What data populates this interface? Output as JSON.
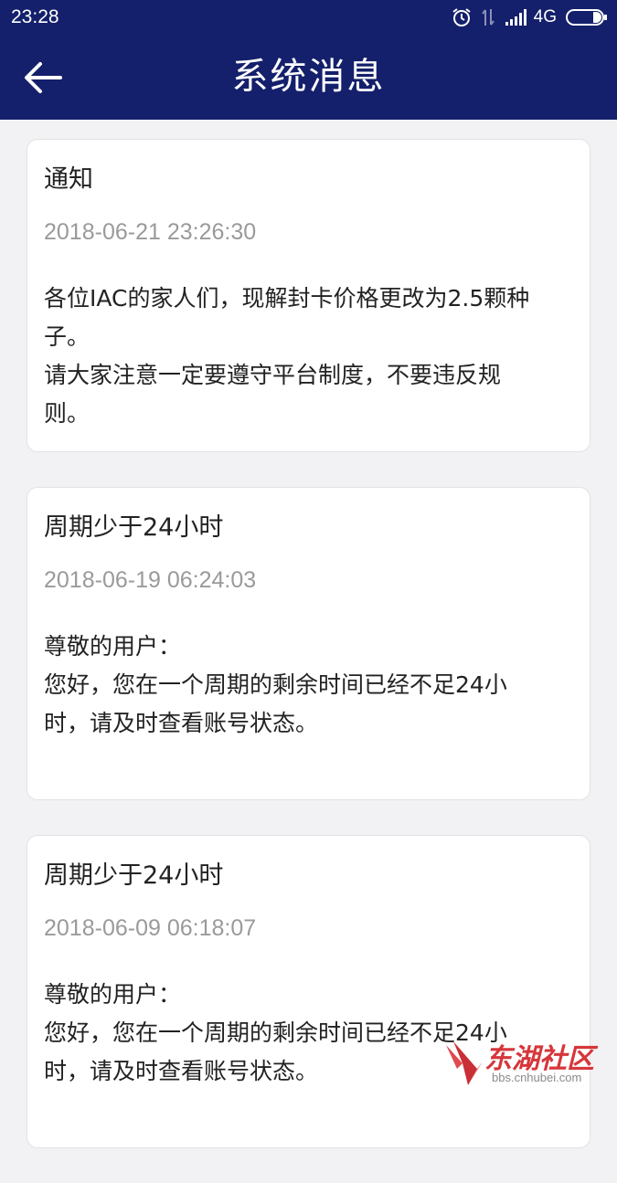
{
  "status_bar": {
    "time": "23:28",
    "network": "4G",
    "icons": [
      "alarm-icon",
      "data-transfer-icon",
      "signal-icon",
      "battery-icon"
    ]
  },
  "app_bar": {
    "title": "系统消息",
    "back_icon": "arrow-left-icon",
    "background_color": "#14206b"
  },
  "messages": [
    {
      "title": "通知",
      "time": "2018-06-21 23:26:30",
      "body": [
        "各位IAC的家人们，现解封卡价格更改为2.5颗种",
        "子。",
        "请大家注意一定要遵守平台制度，不要违反规",
        "则。"
      ]
    },
    {
      "title": "周期少于24小时",
      "time": "2018-06-19 06:24:03",
      "body": [
        "尊敬的用户：",
        "您好，您在一个周期的剩余时间已经不足24小",
        "时，请及时查看账号状态。"
      ]
    },
    {
      "title": "周期少于24小时",
      "time": "2018-06-09 06:18:07",
      "body": [
        "尊敬的用户：",
        "您好，您在一个周期的剩余时间已经不足24小",
        "时，请及时查看账号状态。"
      ]
    }
  ],
  "watermark": {
    "text": "东湖社区",
    "url": "bbs.cnhubei.com",
    "color": "#d6363a"
  }
}
